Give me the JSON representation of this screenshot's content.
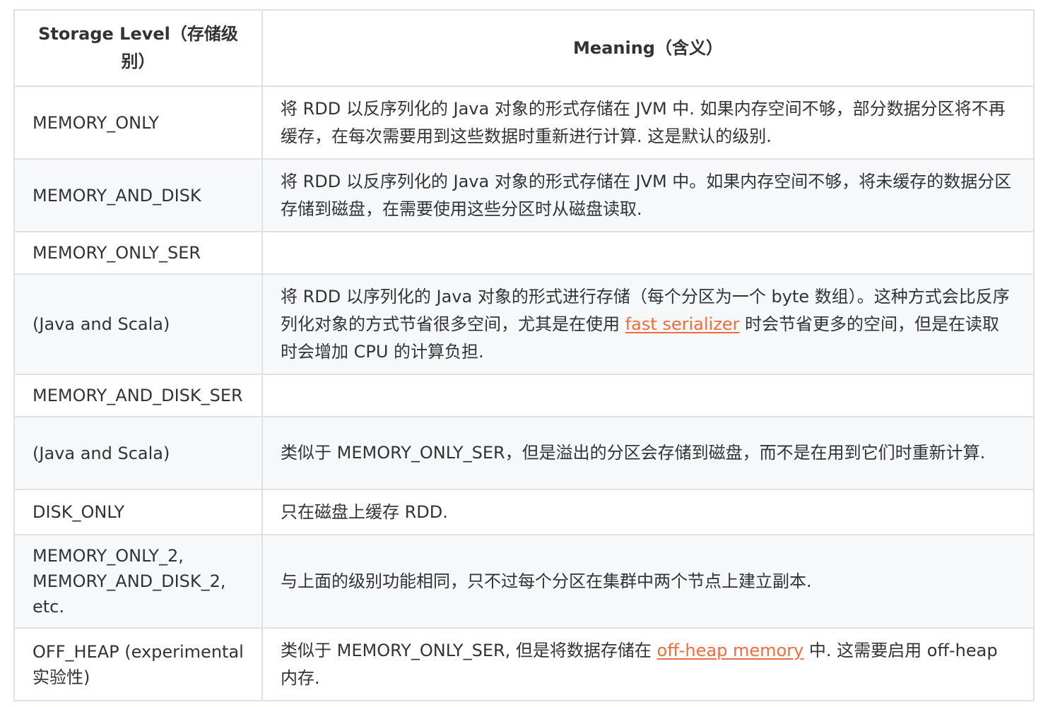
{
  "table": {
    "headers": {
      "level": "Storage Level（存储级别）",
      "meaning": "Meaning（含义）"
    },
    "rows": [
      {
        "level": "MEMORY_ONLY",
        "meaning": "将 RDD 以反序列化的 Java 对象的形式存储在 JVM 中. 如果内存空间不够，部分数据分区将不再缓存，在每次需要用到这些数据时重新进行计算. 这是默认的级别."
      },
      {
        "level": "MEMORY_AND_DISK",
        "meaning": "将 RDD 以反序列化的 Java 对象的形式存储在 JVM 中。如果内存空间不够，将未缓存的数据分区存储到磁盘，在需要使用这些分区时从磁盘读取."
      },
      {
        "level": "MEMORY_ONLY_SER",
        "meaning": ""
      },
      {
        "level": "(Java and Scala)",
        "meaning_before": "将 RDD 以序列化的 Java 对象的形式进行存储（每个分区为一个 byte 数组）。这种方式会比反序列化对象的方式节省很多空间，尤其是在使用 ",
        "meaning_link": "fast serializer",
        "meaning_after": " 时会节省更多的空间，但是在读取时会增加 CPU 的计算负担."
      },
      {
        "level": "MEMORY_AND_DISK_SER",
        "meaning": ""
      },
      {
        "level": "(Java and Scala)",
        "meaning": "类似于 MEMORY_ONLY_SER，但是溢出的分区会存储到磁盘，而不是在用到它们时重新计算."
      },
      {
        "level": "DISK_ONLY",
        "meaning": "只在磁盘上缓存 RDD."
      },
      {
        "level_lines": [
          "MEMORY_ONLY_2,",
          "MEMORY_AND_DISK_2,",
          "etc."
        ],
        "meaning": "与上面的级别功能相同，只不过每个分区在集群中两个节点上建立副本."
      },
      {
        "level": "OFF_HEAP (experimental 实验性)",
        "meaning_before": "类似于 MEMORY_ONLY_SER, 但是将数据存储在 ",
        "meaning_link": "off-heap memory",
        "meaning_after": " 中. 这需要启用 off-heap 内存."
      }
    ],
    "colors": {
      "border": "#dfe2e5",
      "stripe": "#f6f8fa",
      "text": "#333333",
      "link": "#f26d3d"
    }
  }
}
